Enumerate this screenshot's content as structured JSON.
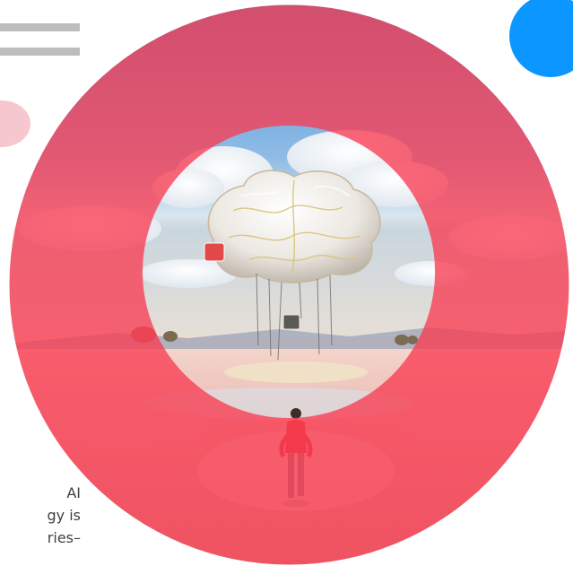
{
  "colors": {
    "outer_ring": "#f83c52",
    "accent_blue": "#0b97ff",
    "accent_pink": "#f6c7cf",
    "menu_gray": "#bdbdbd",
    "text": "#3f3f3f"
  },
  "icons": [
    "menu-icon",
    "brain-illustration"
  ],
  "text_fragment": {
    "lines": [
      "AI",
      "gy is",
      "ries–"
    ]
  }
}
